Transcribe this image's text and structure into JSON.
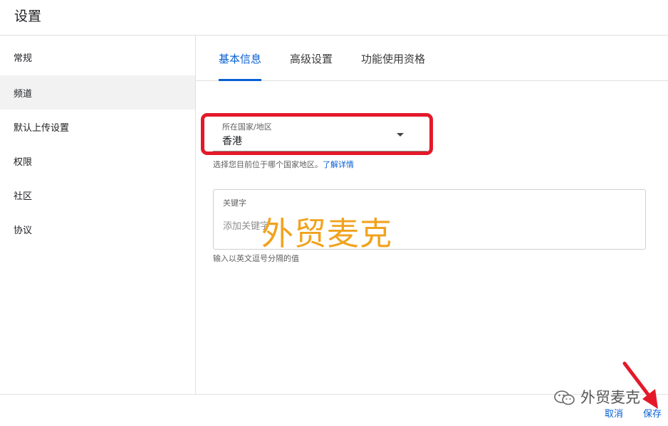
{
  "header": {
    "title": "设置"
  },
  "sidebar": {
    "items": [
      {
        "label": "常规"
      },
      {
        "label": "频道"
      },
      {
        "label": "默认上传设置"
      },
      {
        "label": "权限"
      },
      {
        "label": "社区"
      },
      {
        "label": "协议"
      }
    ],
    "active_index": 1
  },
  "tabs": [
    {
      "label": "基本信息"
    },
    {
      "label": "高级设置"
    },
    {
      "label": "功能使用资格"
    }
  ],
  "country": {
    "label": "所在国家/地区",
    "value": "香港",
    "helper_text": "选择您目前位于哪个国家地区。",
    "helper_link": "了解详情"
  },
  "keywords": {
    "label": "关键字",
    "placeholder": "添加关键字",
    "hint": "输入以英文逗号分隔的值"
  },
  "watermark": {
    "center_text": "外贸麦克",
    "corner_text": "外贸麦克"
  },
  "footer": {
    "cancel_label": "取消",
    "save_label": "保存"
  },
  "colors": {
    "accent": "#065fd4",
    "highlight": "#e3192a",
    "watermark": "#f0a31f"
  },
  "icons": {
    "dropdown": "dropdown-arrow-icon",
    "wechat": "wechat-icon",
    "annotation": "red-arrow-icon"
  }
}
